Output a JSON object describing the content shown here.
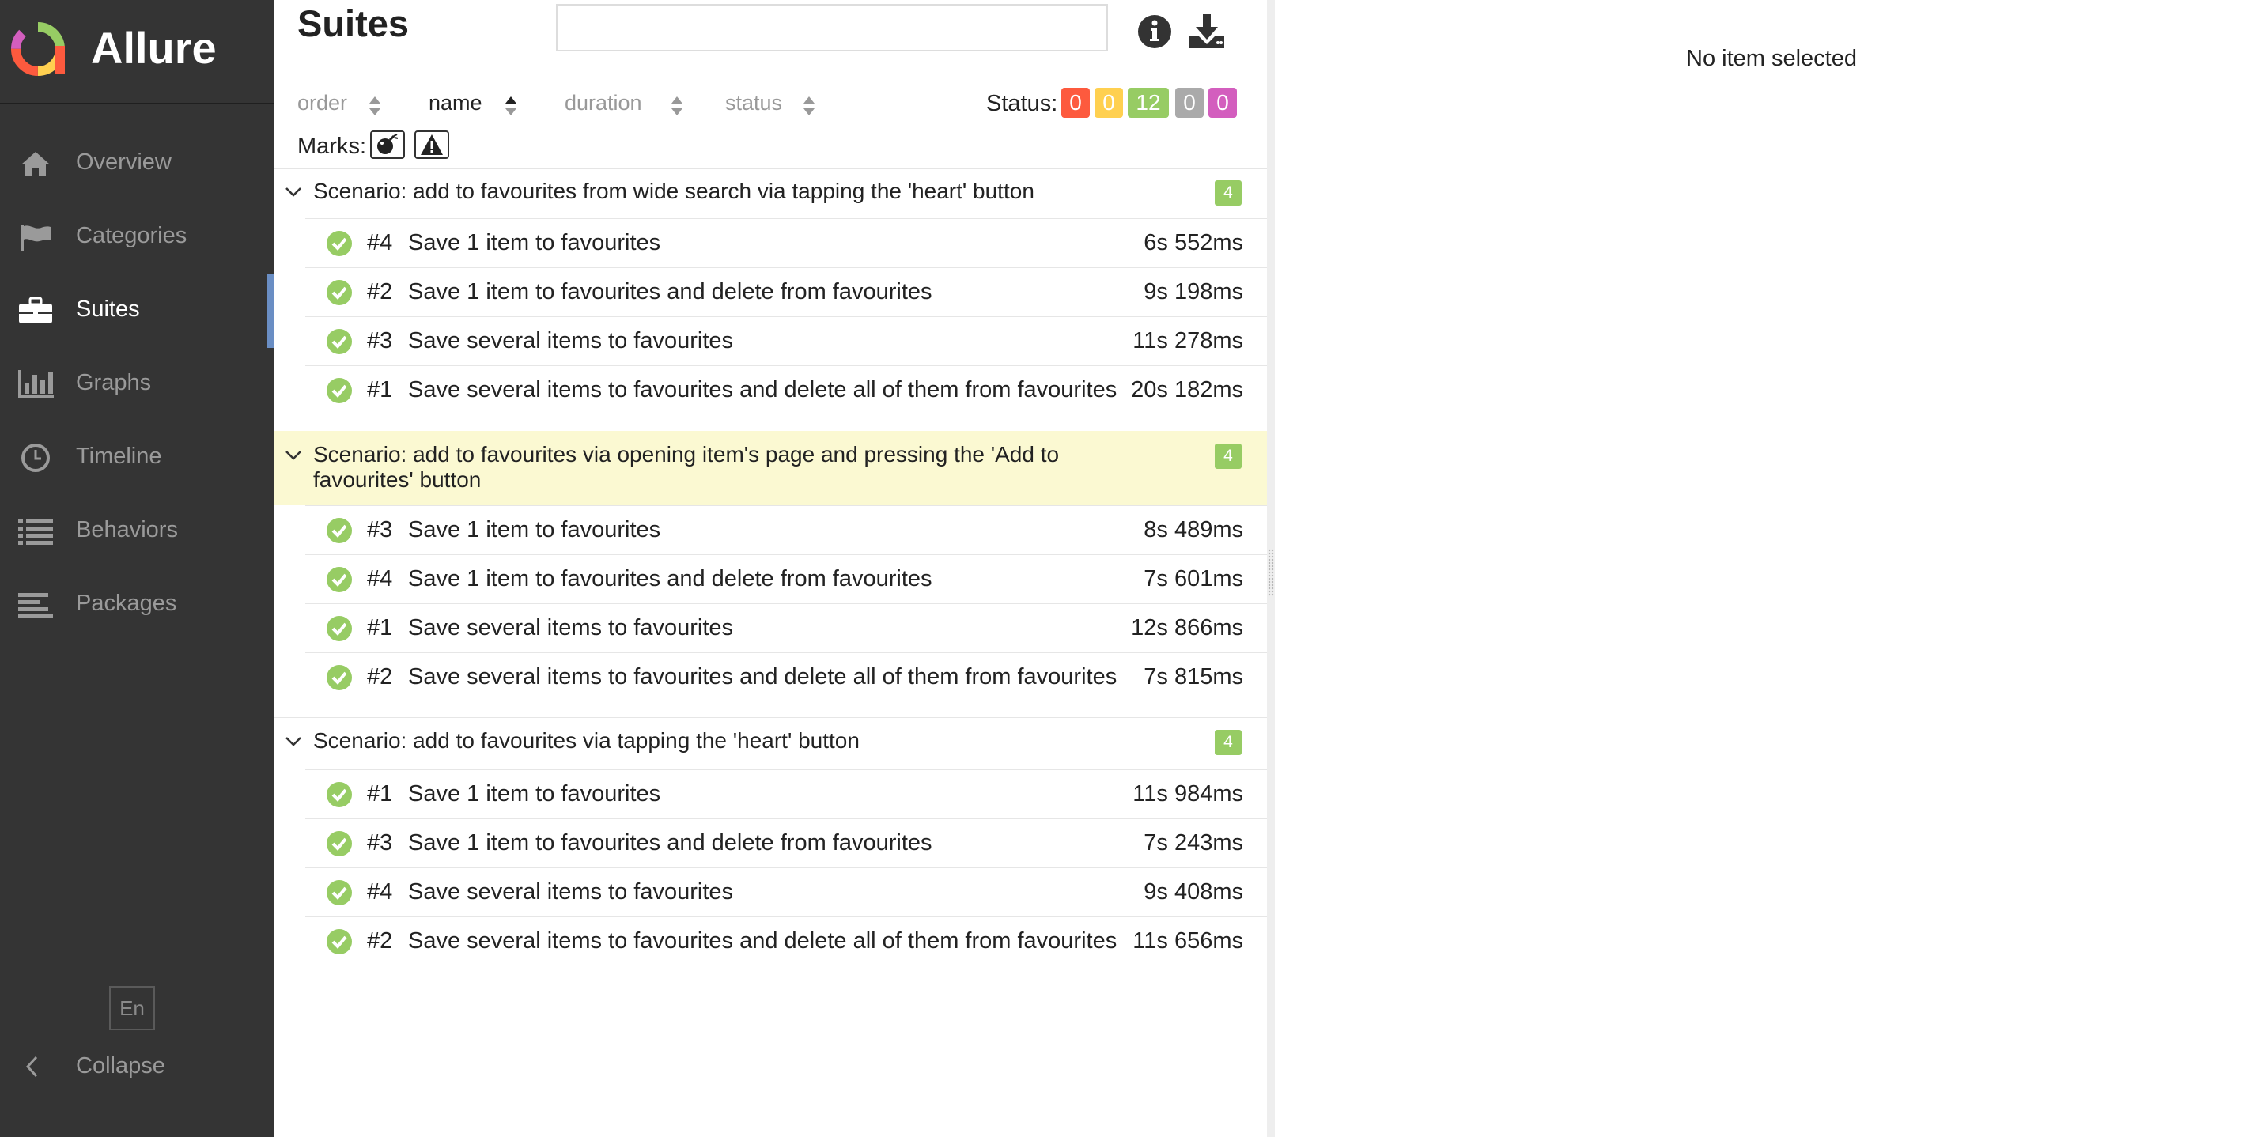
{
  "app": {
    "name": "Allure"
  },
  "sidebar": {
    "items": [
      {
        "label": "Overview",
        "icon": "home-icon"
      },
      {
        "label": "Categories",
        "icon": "flag-icon"
      },
      {
        "label": "Suites",
        "icon": "briefcase-icon"
      },
      {
        "label": "Graphs",
        "icon": "bar-chart-icon"
      },
      {
        "label": "Timeline",
        "icon": "clock-icon"
      },
      {
        "label": "Behaviors",
        "icon": "list-icon"
      },
      {
        "label": "Packages",
        "icon": "align-left-icon"
      }
    ],
    "language": "En",
    "collapse_label": "Collapse"
  },
  "pane": {
    "title": "Suites",
    "search": {
      "value": "",
      "placeholder": ""
    },
    "sorters": {
      "order": "order",
      "name": "name",
      "duration": "duration",
      "status": "status"
    },
    "status_label": "Status:",
    "status_counts": {
      "failed": "0",
      "broken": "0",
      "passed": "12",
      "skipped": "0",
      "unknown": "0"
    },
    "status_colors": {
      "failed": "#fd5a3e",
      "broken": "#ffd050",
      "passed": "#97cc64",
      "skipped": "#aaaaaa",
      "unknown": "#d35ebe"
    },
    "marks_label": "Marks:"
  },
  "groups": [
    {
      "title": "Scenario: add to favourites from wide search via tapping the 'heart' button",
      "count": "4",
      "tests": [
        {
          "num": "#4",
          "name": "Save 1 item to favourites",
          "duration": "6s 552ms"
        },
        {
          "num": "#2",
          "name": "Save 1 item to favourites and delete from favourites",
          "duration": "9s 198ms"
        },
        {
          "num": "#3",
          "name": "Save several items to favourites",
          "duration": "11s 278ms"
        },
        {
          "num": "#1",
          "name": "Save several items to favourites and delete all of them from favourites",
          "duration": "20s 182ms"
        }
      ]
    },
    {
      "title": "Scenario: add to favourites via opening item's page and pressing the 'Add to favourites' button",
      "count": "4",
      "tests": [
        {
          "num": "#3",
          "name": "Save 1 item to favourites",
          "duration": "8s 489ms"
        },
        {
          "num": "#4",
          "name": "Save 1 item to favourites and delete from favourites",
          "duration": "7s 601ms"
        },
        {
          "num": "#1",
          "name": "Save several items to favourites",
          "duration": "12s 866ms"
        },
        {
          "num": "#2",
          "name": "Save several items to favourites and delete all of them from favourites",
          "duration": "7s 815ms"
        }
      ]
    },
    {
      "title": "Scenario: add to favourites via tapping the 'heart' button",
      "count": "4",
      "tests": [
        {
          "num": "#1",
          "name": "Save 1 item to favourites",
          "duration": "11s 984ms"
        },
        {
          "num": "#3",
          "name": "Save 1 item to favourites and delete from favourites",
          "duration": "7s 243ms"
        },
        {
          "num": "#4",
          "name": "Save several items to favourites",
          "duration": "9s 408ms"
        },
        {
          "num": "#2",
          "name": "Save several items to favourites and delete all of them from favourites",
          "duration": "11s 656ms"
        }
      ]
    }
  ],
  "detail": {
    "empty_text": "No item selected"
  }
}
